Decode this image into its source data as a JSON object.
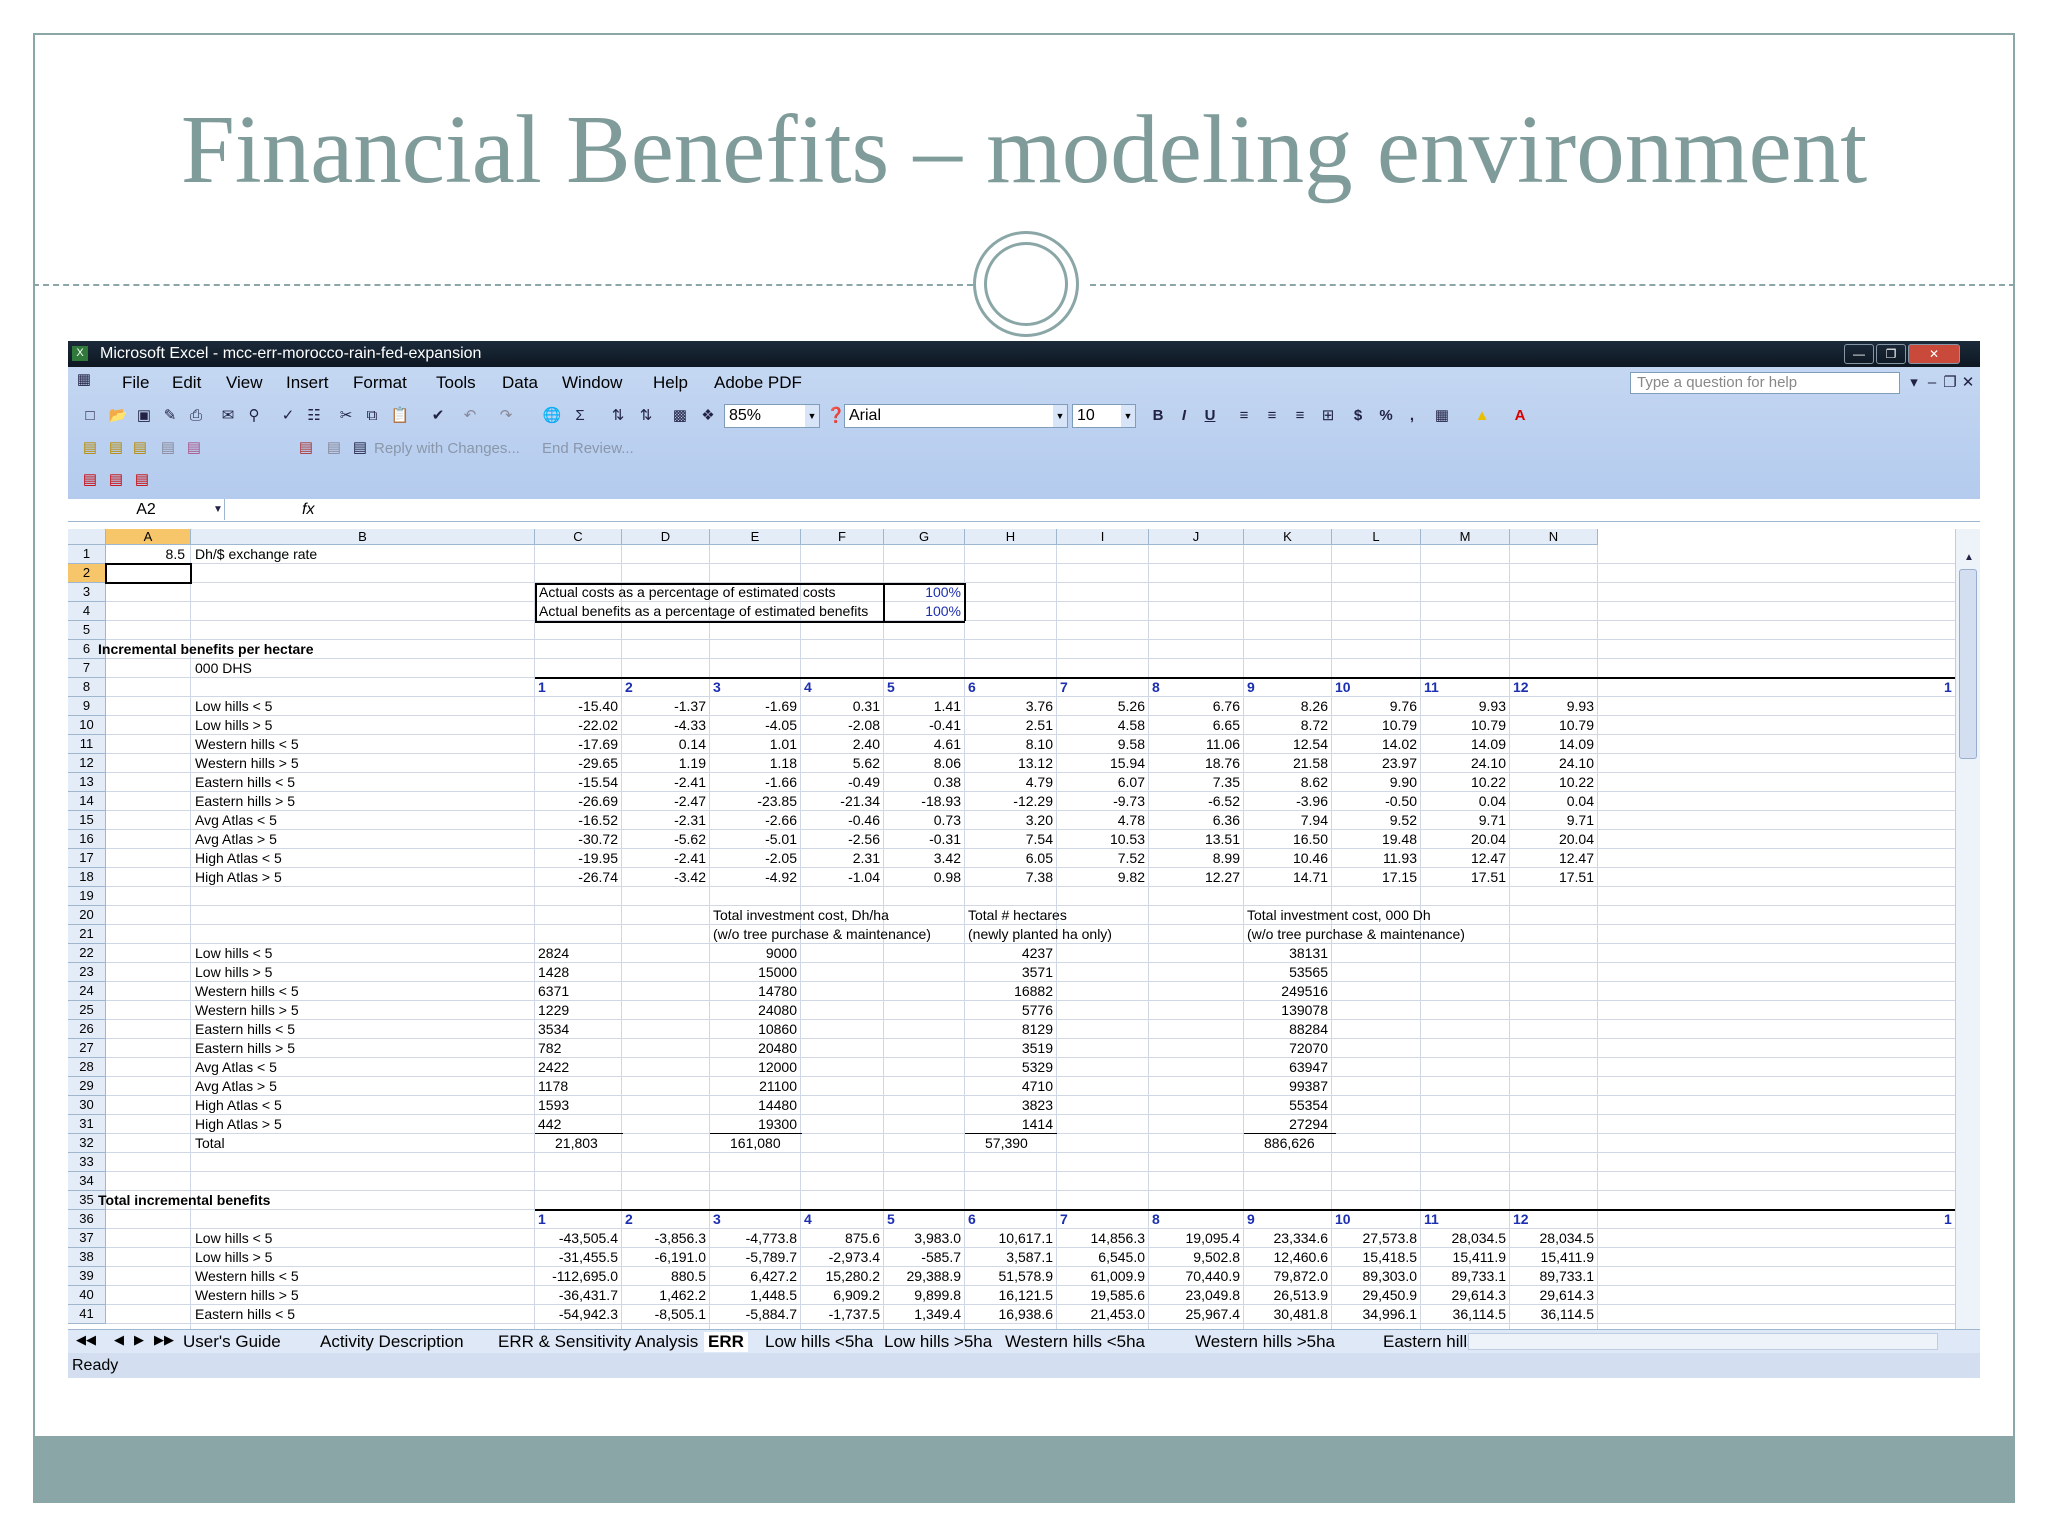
{
  "slide": {
    "title": "Financial Benefits – modeling environment"
  },
  "window": {
    "title": "Microsoft Excel - mcc-err-morocco-rain-fed-expansion"
  },
  "menu": [
    "File",
    "Edit",
    "View",
    "Insert",
    "Format",
    "Tools",
    "Data",
    "Window",
    "Help",
    "Adobe PDF"
  ],
  "help_placeholder": "Type a question for help",
  "toolbar": {
    "zoom": "85%",
    "font": "Arial",
    "font_size": "10",
    "reply_label": "Reply with Changes...",
    "end_review_label": "End Review...",
    "bold": "B",
    "italic": "I",
    "underline": "U",
    "currency": "$",
    "percent": "%",
    "comma": ","
  },
  "namebox": "A2",
  "fx": "fx",
  "columns": [
    "A",
    "B",
    "C",
    "D",
    "E",
    "F",
    "G",
    "H",
    "I",
    "J",
    "K",
    "L",
    "M",
    "N"
  ],
  "rows": [
    "1",
    "2",
    "3",
    "4",
    "5",
    "6",
    "7",
    "8",
    "9",
    "10",
    "11",
    "12",
    "13",
    "14",
    "15",
    "16",
    "17",
    "18",
    "19",
    "20",
    "21",
    "22",
    "23",
    "24",
    "25",
    "26",
    "27",
    "28",
    "29",
    "30",
    "31",
    "32",
    "33",
    "34",
    "35",
    "36",
    "37",
    "38",
    "39",
    "40",
    "41"
  ],
  "sheet": {
    "a1": "8.5",
    "b1": "Dh/$ exchange rate",
    "row3_label": "Actual costs as a percentage of estimated costs",
    "row3_value": "100%",
    "row4_label": "Actual benefits as a percentage of estimated benefits",
    "row4_value": "100%",
    "section1": "Incremental benefits per hectare",
    "unit": "000 DHS",
    "year_headers": [
      "1",
      "2",
      "3",
      "4",
      "5",
      "6",
      "7",
      "8",
      "9",
      "10",
      "11",
      "12",
      "1"
    ],
    "regions": [
      "Low hills < 5",
      "Low hills > 5",
      "Western hills < 5",
      "Western hills > 5",
      "Eastern hills < 5",
      "Eastern hills > 5",
      "Avg Atlas < 5",
      "Avg Atlas > 5",
      "High Atlas < 5",
      "High Atlas > 5"
    ],
    "benefits_per_ha": [
      [
        "-15.40",
        "-1.37",
        "-1.69",
        "0.31",
        "1.41",
        "3.76",
        "5.26",
        "6.76",
        "8.26",
        "9.76",
        "9.93",
        "9.93"
      ],
      [
        "-22.02",
        "-4.33",
        "-4.05",
        "-2.08",
        "-0.41",
        "2.51",
        "4.58",
        "6.65",
        "8.72",
        "10.79",
        "10.79",
        "10.79"
      ],
      [
        "-17.69",
        "0.14",
        "1.01",
        "2.40",
        "4.61",
        "8.10",
        "9.58",
        "11.06",
        "12.54",
        "14.02",
        "14.09",
        "14.09"
      ],
      [
        "-29.65",
        "1.19",
        "1.18",
        "5.62",
        "8.06",
        "13.12",
        "15.94",
        "18.76",
        "21.58",
        "23.97",
        "24.10",
        "24.10"
      ],
      [
        "-15.54",
        "-2.41",
        "-1.66",
        "-0.49",
        "0.38",
        "4.79",
        "6.07",
        "7.35",
        "8.62",
        "9.90",
        "10.22",
        "10.22"
      ],
      [
        "-26.69",
        "-2.47",
        "-23.85",
        "-21.34",
        "-18.93",
        "-12.29",
        "-9.73",
        "-6.52",
        "-3.96",
        "-0.50",
        "0.04",
        "0.04"
      ],
      [
        "-16.52",
        "-2.31",
        "-2.66",
        "-0.46",
        "0.73",
        "3.20",
        "4.78",
        "6.36",
        "7.94",
        "9.52",
        "9.71",
        "9.71"
      ],
      [
        "-30.72",
        "-5.62",
        "-5.01",
        "-2.56",
        "-0.31",
        "7.54",
        "10.53",
        "13.51",
        "16.50",
        "19.48",
        "20.04",
        "20.04"
      ],
      [
        "-19.95",
        "-2.41",
        "-2.05",
        "2.31",
        "3.42",
        "6.05",
        "7.52",
        "8.99",
        "10.46",
        "11.93",
        "12.47",
        "12.47"
      ],
      [
        "-26.74",
        "-3.42",
        "-4.92",
        "-1.04",
        "0.98",
        "7.38",
        "9.82",
        "12.27",
        "14.71",
        "17.15",
        "17.51",
        "17.51"
      ]
    ],
    "inv_header1": "Total investment cost, Dh/ha",
    "inv_header1b": "(w/o tree purchase & maintenance)",
    "ha_header1": "Total # hectares",
    "ha_header1b": "(newly planted ha only)",
    "inv_header2": "Total investment cost, 000 Dh",
    "inv_header2b": "(w/o tree purchase & maintenance)",
    "c_values": [
      "2824",
      "1428",
      "6371",
      "1229",
      "3534",
      "782",
      "2422",
      "1178",
      "1593",
      "442"
    ],
    "inv_values": [
      "9000",
      "15000",
      "14780",
      "24080",
      "10860",
      "20480",
      "12000",
      "21100",
      "14480",
      "19300"
    ],
    "ha_values": [
      "4237",
      "3571",
      "16882",
      "5776",
      "8129",
      "3519",
      "5329",
      "4710",
      "3823",
      "1414"
    ],
    "cost_values": [
      "38131",
      "53565",
      "249516",
      "139078",
      "88284",
      "72070",
      "63947",
      "99387",
      "55354",
      "27294"
    ],
    "total_label": "Total",
    "totals": [
      "21,803",
      "161,080",
      "57,390",
      "886,626"
    ],
    "section2": "Total incremental benefits",
    "total_benefits": [
      [
        "-43,505.4",
        "-3,856.3",
        "-4,773.8",
        "875.6",
        "3,983.0",
        "10,617.1",
        "14,856.3",
        "19,095.4",
        "23,334.6",
        "27,573.8",
        "28,034.5",
        "28,034.5"
      ],
      [
        "-31,455.5",
        "-6,191.0",
        "-5,789.7",
        "-2,973.4",
        "-585.7",
        "3,587.1",
        "6,545.0",
        "9,502.8",
        "12,460.6",
        "15,418.5",
        "15,411.9",
        "15,411.9"
      ],
      [
        "-112,695.0",
        "880.5",
        "6,427.2",
        "15,280.2",
        "29,388.9",
        "51,578.9",
        "61,009.9",
        "70,440.9",
        "79,872.0",
        "89,303.0",
        "89,733.1",
        "89,733.1"
      ],
      [
        "-36,431.7",
        "1,462.2",
        "1,448.5",
        "6,909.2",
        "9,899.8",
        "16,121.5",
        "19,585.6",
        "23,049.8",
        "26,513.9",
        "29,450.9",
        "29,614.3",
        "29,614.3"
      ],
      [
        "-54,942.3",
        "-8,505.1",
        "-5,884.7",
        "-1,737.5",
        "1,349.4",
        "16,938.6",
        "21,453.0",
        "25,967.4",
        "30,481.8",
        "34,996.1",
        "36,114.5",
        "36,114.5"
      ]
    ]
  },
  "tabs": [
    "User's Guide",
    "Activity Description",
    "ERR & Sensitivity Analysis",
    "ERR",
    "Low hills <5ha",
    "Low hills >5ha",
    "Western hills <5ha",
    "Western hills >5ha",
    "Eastern hills <"
  ],
  "active_tab": "ERR",
  "status": "Ready",
  "colors": {
    "accent": "#8aa6a6",
    "title_text": "#7f9c9a",
    "excel_toolbar": "#c4d7f2",
    "selection_header": "#f7c56a",
    "blue_value": "#1c2fb0"
  },
  "icons": [
    "excel-app-icon",
    "new-icon",
    "open-icon",
    "save-icon",
    "permission-icon",
    "print-icon",
    "print-preview-icon",
    "spelling-icon",
    "research-icon",
    "cut-icon",
    "copy-icon",
    "paste-icon",
    "format-painter-icon",
    "undo-icon",
    "redo-icon",
    "hyperlink-icon",
    "autosum-icon",
    "sort-asc-icon",
    "sort-desc-icon",
    "chart-wizard-icon",
    "drawing-icon",
    "help-icon",
    "align-left-icon",
    "center-icon",
    "align-right-icon",
    "merge-icon",
    "borders-icon",
    "fill-color-icon",
    "font-color-icon",
    "pdf-icon"
  ]
}
